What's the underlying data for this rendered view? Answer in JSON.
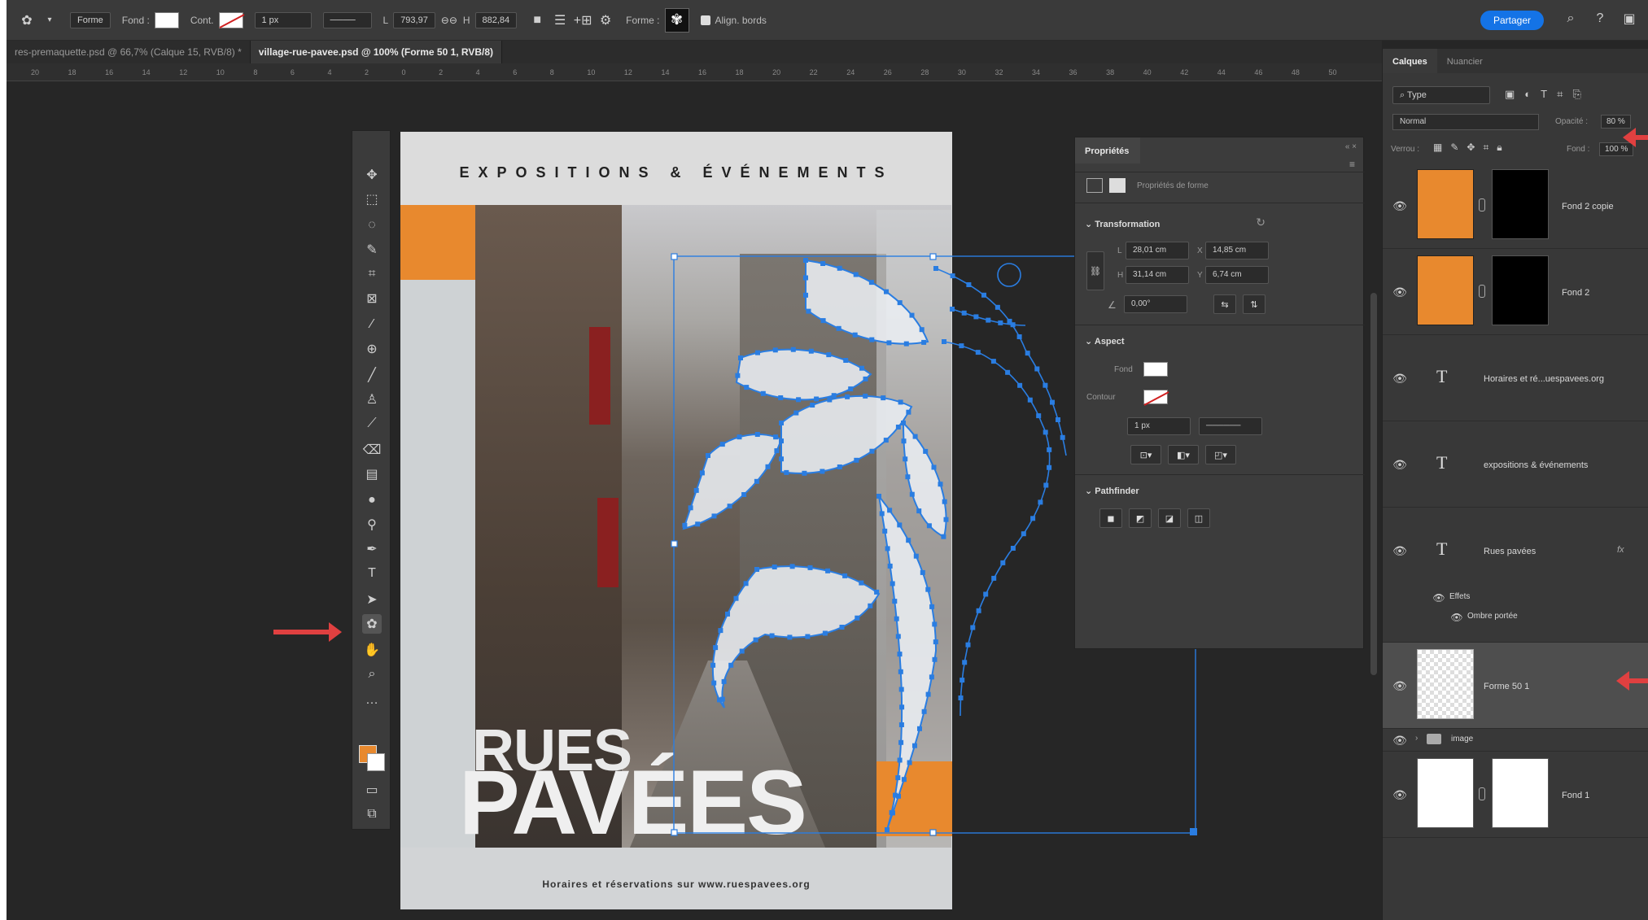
{
  "options_bar": {
    "tool_mode": "Forme",
    "fill_label": "Fond :",
    "stroke_label": "Cont.",
    "stroke_width": "1 px",
    "w_label": "L",
    "w_value": "793,97",
    "h_label": "H",
    "h_value": "882,84",
    "shape_label": "Forme :",
    "align_edges": "Align. bords",
    "share": "Partager"
  },
  "tabs": [
    {
      "label": "res-premaquette.psd @ 66,7% (Calque 15, RVB/8) *"
    },
    {
      "label": "village-rue-pavee.psd @ 100% (Forme 50 1, RVB/8)"
    }
  ],
  "ruler": [
    "20",
    "18",
    "16",
    "14",
    "12",
    "10",
    "8",
    "6",
    "4",
    "2",
    "0",
    "2",
    "4",
    "6",
    "8",
    "10",
    "12",
    "14",
    "16",
    "18",
    "20",
    "22",
    "24",
    "26",
    "28",
    "30",
    "32",
    "34",
    "36",
    "38",
    "40",
    "42",
    "44",
    "46",
    "48",
    "50"
  ],
  "document": {
    "headline": "EXPOSITIONS & ÉVÉNEMENTS",
    "title_line1": "RUES",
    "title_line2": "PAVÉES",
    "footer": "Horaires et réservations sur www.ruespavees.org"
  },
  "properties": {
    "tab": "Propriétés",
    "subtitle": "Propriétés de forme",
    "transformation": "Transformation",
    "w_label": "L",
    "w": "28,01 cm",
    "x_label": "X",
    "x": "14,85 cm",
    "h_label": "H",
    "h": "31,14 cm",
    "y_label": "Y",
    "y": "6,74 cm",
    "angle": "0,00°",
    "aspect": "Aspect",
    "fill_label": "Fond",
    "stroke_label": "Contour",
    "stroke_width": "1 px",
    "pathfinder": "Pathfinder"
  },
  "layers_panel": {
    "tab_layers": "Calques",
    "tab_other": "Nuancier",
    "filter": "Type",
    "blend_mode": "Normal",
    "opacity_label": "Opacité :",
    "opacity": "80 %",
    "lock_label": "Verrou :",
    "fill_label": "Fond :",
    "fill": "100 %",
    "layers": [
      {
        "name": "Fond 2 copie",
        "kind": "masked"
      },
      {
        "name": "Fond 2",
        "kind": "masked"
      },
      {
        "name": "Horaires et ré...uespavees.org",
        "kind": "text"
      },
      {
        "name": "expositions & événements",
        "kind": "text"
      },
      {
        "name": "Rues pavées",
        "kind": "text",
        "fx": "fx"
      },
      {
        "name": "Effets",
        "kind": "effect"
      },
      {
        "name": "Ombre portée",
        "kind": "effect"
      },
      {
        "name": "Forme 50 1",
        "kind": "shape"
      },
      {
        "name": "image",
        "kind": "group"
      },
      {
        "name": "Fond 1",
        "kind": "masked-white"
      }
    ]
  },
  "colors": {
    "accent_orange": "#e8892e",
    "path_blue": "#2a7de1",
    "share_blue": "#1473e6",
    "annotation_red": "#e04040"
  }
}
